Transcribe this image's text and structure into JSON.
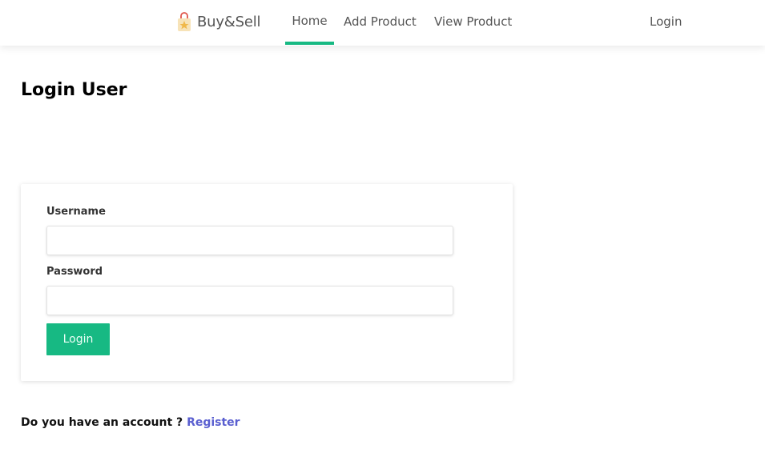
{
  "navbar": {
    "brand": {
      "text": "Buy&Sell",
      "icon": "shopping-bag-icon"
    },
    "links": {
      "home": "Home",
      "add_product": "Add Product",
      "view_product": "View Product",
      "login": "Login"
    },
    "active": "home",
    "accent_color": "#17b983"
  },
  "page": {
    "title": "Login User"
  },
  "form": {
    "username_label": "Username",
    "username_value": "",
    "password_label": "Password",
    "password_value": "",
    "submit_label": "Login"
  },
  "footer": {
    "prompt": "Do you have an account ? ",
    "register_link": "Register"
  },
  "colors": {
    "primary": "#17b983",
    "link": "#5a5fd0"
  }
}
